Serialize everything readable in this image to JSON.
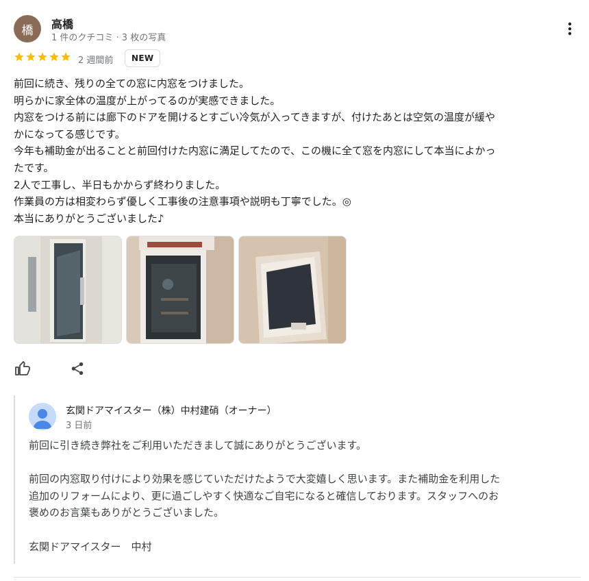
{
  "review": {
    "avatar_letter": "橋",
    "reviewer_name": "高橋",
    "reviewer_meta": "1 件のクチコミ · 3 枚の写真",
    "rating": 5,
    "time_ago": "2 週間前",
    "new_badge": "NEW",
    "text_lines": [
      "前回に続き、残りの全ての窓に内窓をつけました。",
      "明らかに家全体の温度が上がってるのが実感できました。",
      "内窓をつける前には廊下のドアを開けるとすごい冷気が入ってきますが、付けたあとは空気の温度が緩や",
      "かになってる感じです。",
      "今年も補助金が出ることと前回付けた内窓に満足してたので、この機に全て窓を内窓にして本当によかっ",
      "たです。",
      "2人で工事し、半日もかからず終わりました。",
      "作業員の方は相変わらず優しく工事後の注意事項や説明も丁寧でした。◎",
      "本当にありがとうございました♪"
    ],
    "colors": {
      "star": "#fbbc04",
      "avatar_bg": "#8a6b57"
    }
  },
  "actions": {
    "like_icon": "thumb-up-icon",
    "share_icon": "share-icon"
  },
  "owner_reply": {
    "name": "玄関ドアマイスター（株）中村建硝（オーナー）",
    "time_ago": "3 日前",
    "text_lines": [
      "前回に引き続き弊社をご利用いただきまして誠にありがとうございます。",
      "",
      "前回の内窓取り付けにより効果を感じていただけたようで大変嬉しく思います。また補助金を利用した",
      "追加のリフォームにより、更に過ごしやすく快適なご自宅になると確信しております。スタッフへのお",
      "褒めのお言葉もありがとうございました。",
      "",
      "玄関ドアマイスター　中村"
    ]
  }
}
